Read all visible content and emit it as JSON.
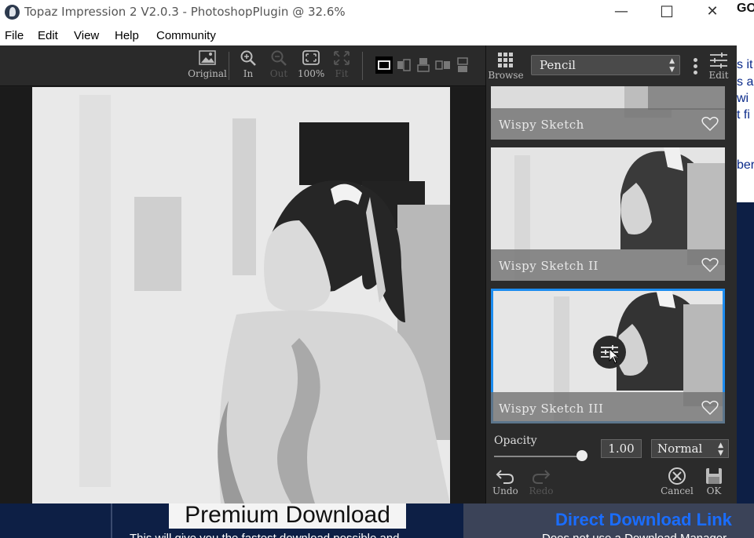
{
  "window": {
    "title": "Topaz Impression 2 V2.0.3 - PhotoshopPlugin @ 32.6%",
    "controls": {
      "minimize": "—",
      "maximize": "☐",
      "close": "✕"
    }
  },
  "menu": [
    "File",
    "Edit",
    "View",
    "Help",
    "Community"
  ],
  "toolbar": {
    "original": "Original",
    "zoom_in": "In",
    "zoom_out": "Out",
    "zoom_100": "100%",
    "fit": "Fit"
  },
  "panel": {
    "browse_label": "Browse",
    "preset_category": "Pencil",
    "edit_label": "Edit",
    "presets": [
      {
        "name": "Wispy Sketch"
      },
      {
        "name": "Wispy Sketch II"
      },
      {
        "name": "Wispy Sketch III",
        "selected": true
      }
    ],
    "opacity_label": "Opacity",
    "opacity_value": "1.00",
    "opacity_fraction": 1.0,
    "blend_mode": "Normal",
    "undo": "Undo",
    "redo": "Redo",
    "cancel": "Cancel",
    "ok": "OK"
  },
  "background_page": {
    "premium": "Premium Download",
    "direct_link": "Direct Download Link",
    "sub_left": "This will give you the fastest download possible and",
    "sub_right": "Does not use a Download Manager",
    "right_snippets": [
      "GO",
      "s it",
      "s ar",
      "wi",
      "t fi",
      "ber"
    ]
  },
  "colors": {
    "accent": "#1c8cf0",
    "panel": "#2b2b2b",
    "link": "#1a6dff"
  }
}
